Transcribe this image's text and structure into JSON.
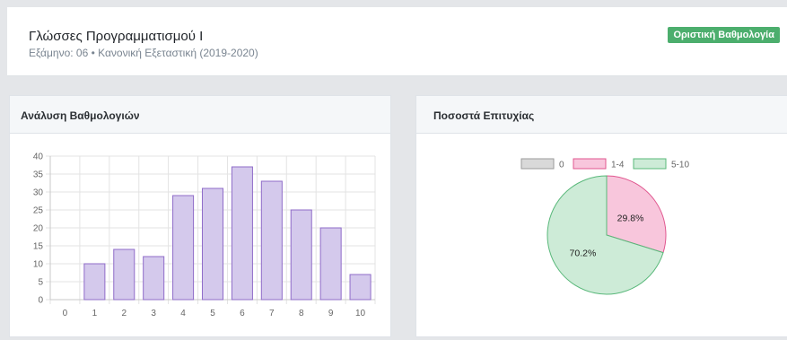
{
  "header": {
    "course_title": "Γλώσσες Προγραμματισμού Ι",
    "subtitle": "Εξάμηνο: 06 • Κανονική Εξεταστική (2019-2020)",
    "badge": "Οριστική Βαθμολογία"
  },
  "grades_card": {
    "title": "Ανάλυση Βαθμολογιών"
  },
  "success_card": {
    "title": "Ποσοστά Επιτυχίας"
  },
  "colors": {
    "badge": "#4cae6d",
    "bar_fill": "#d4c9ec",
    "bar_stroke": "#8f6cc9",
    "pie_zero": "#d9d9d9",
    "pie_fail": "#f8c6dc",
    "pie_pass": "#cdebd7"
  },
  "chart_data": [
    {
      "type": "bar",
      "categories": [
        "0",
        "1",
        "2",
        "3",
        "4",
        "5",
        "6",
        "7",
        "8",
        "9",
        "10"
      ],
      "values": [
        0,
        10,
        14,
        12,
        29,
        31,
        37,
        33,
        25,
        20,
        7
      ],
      "ylim": [
        0,
        40
      ],
      "yticks": [
        0,
        5,
        10,
        15,
        20,
        25,
        30,
        35,
        40
      ],
      "grid": true
    },
    {
      "type": "pie",
      "legend_position": "top",
      "slices": [
        {
          "label": "0",
          "value": 0,
          "color": "#d9d9d9",
          "stroke": "#9a9a9a"
        },
        {
          "label": "1-4",
          "value": 29.8,
          "color": "#f8c6dc",
          "stroke": "#e0578f",
          "display": "29.8%"
        },
        {
          "label": "5-10",
          "value": 70.2,
          "color": "#cdebd7",
          "stroke": "#59b87a",
          "display": "70.2%"
        }
      ]
    }
  ]
}
